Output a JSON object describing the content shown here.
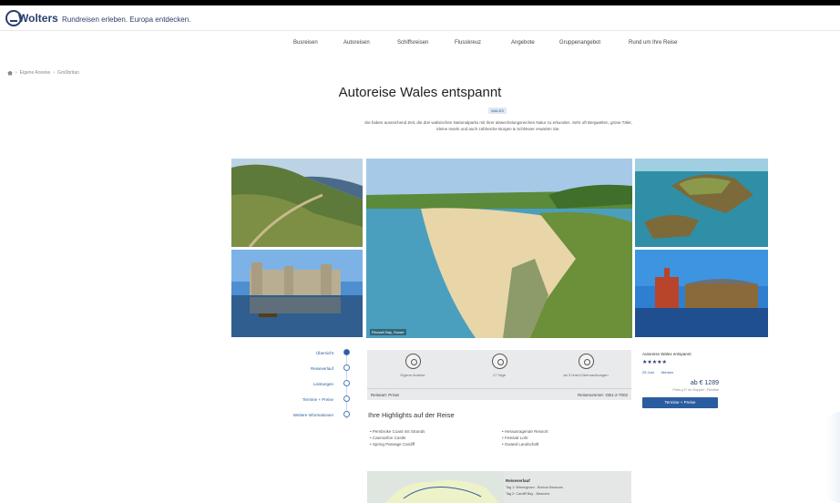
{
  "header": {
    "logo_text": "Wolters",
    "tagline": "Rundreisen erleben. Europa entdecken."
  },
  "nav": {
    "items": [
      {
        "label": "Busreisen"
      },
      {
        "label": "Autoreisen"
      },
      {
        "label": "Schiffsreisen"
      },
      {
        "label": "Flusskreuz"
      },
      {
        "label": "Angebote"
      },
      {
        "label": "Gruppenangebot"
      },
      {
        "label": "Rund um Ihre Reise"
      }
    ]
  },
  "breadcrumb": [
    "Eigene Anreise",
    "Großbritan"
  ],
  "page": {
    "title": "Autoreise Wales entspannt",
    "badge": "WALES",
    "intro": "Sie haben ausreichend Zeit, die drei walisischen Nationalparks mit ihrer abwechslungsreichen Natur zu erkunden. Sehr oft Bergwelten, grüne Täler, kleine Inseln und auch zahlreiche Burgen & Schlösser erwarten Sie."
  },
  "gallery": {
    "main_caption": "Rhossili Bay, Gower"
  },
  "sidenav": {
    "items": [
      {
        "label": "Übersicht",
        "active": true
      },
      {
        "label": "Reiseverlauf",
        "active": false
      },
      {
        "label": "Leistungen",
        "active": false
      },
      {
        "label": "Termine + Preise",
        "active": false
      },
      {
        "label": "Weitere Informationen",
        "active": false
      }
    ]
  },
  "facts": {
    "items": [
      {
        "icon": "car-icon",
        "label": "Eigene Anreise"
      },
      {
        "icon": "calendar-icon",
        "label": "17 Tage"
      },
      {
        "icon": "hotel-icon",
        "label": "ab 3 Hotel-Übernachtungen"
      }
    ],
    "bottom_left": "Reiseart: Privat",
    "bottom_right": "Reisenummer: GB1-2-7002"
  },
  "booking": {
    "title": "Autoreise Wales entspannt",
    "stars": "★★★★★",
    "meta_left": "25 Juni",
    "meta_right": "Merken",
    "price": "ab € 1289",
    "price_note": "Preis p.P. im Doppel - Flexibel",
    "button_label": "Termine + Preise"
  },
  "highlights": {
    "title": "Ihre Highlights auf der Reise",
    "col1": [
      "Pembroke Coast mit Strands",
      "Caernarfon Castle",
      "Spring Passage Cardiff"
    ],
    "col2": [
      "Herausragende Ressort",
      "Festival Lohr",
      "Gwaed Landschaft"
    ]
  },
  "map": {
    "label": "Reiseverlauf",
    "lines": [
      "Tag 1: Birmingham - Brecon Beacons",
      "Tag 2: Cardiff Bay - Beacons"
    ]
  }
}
